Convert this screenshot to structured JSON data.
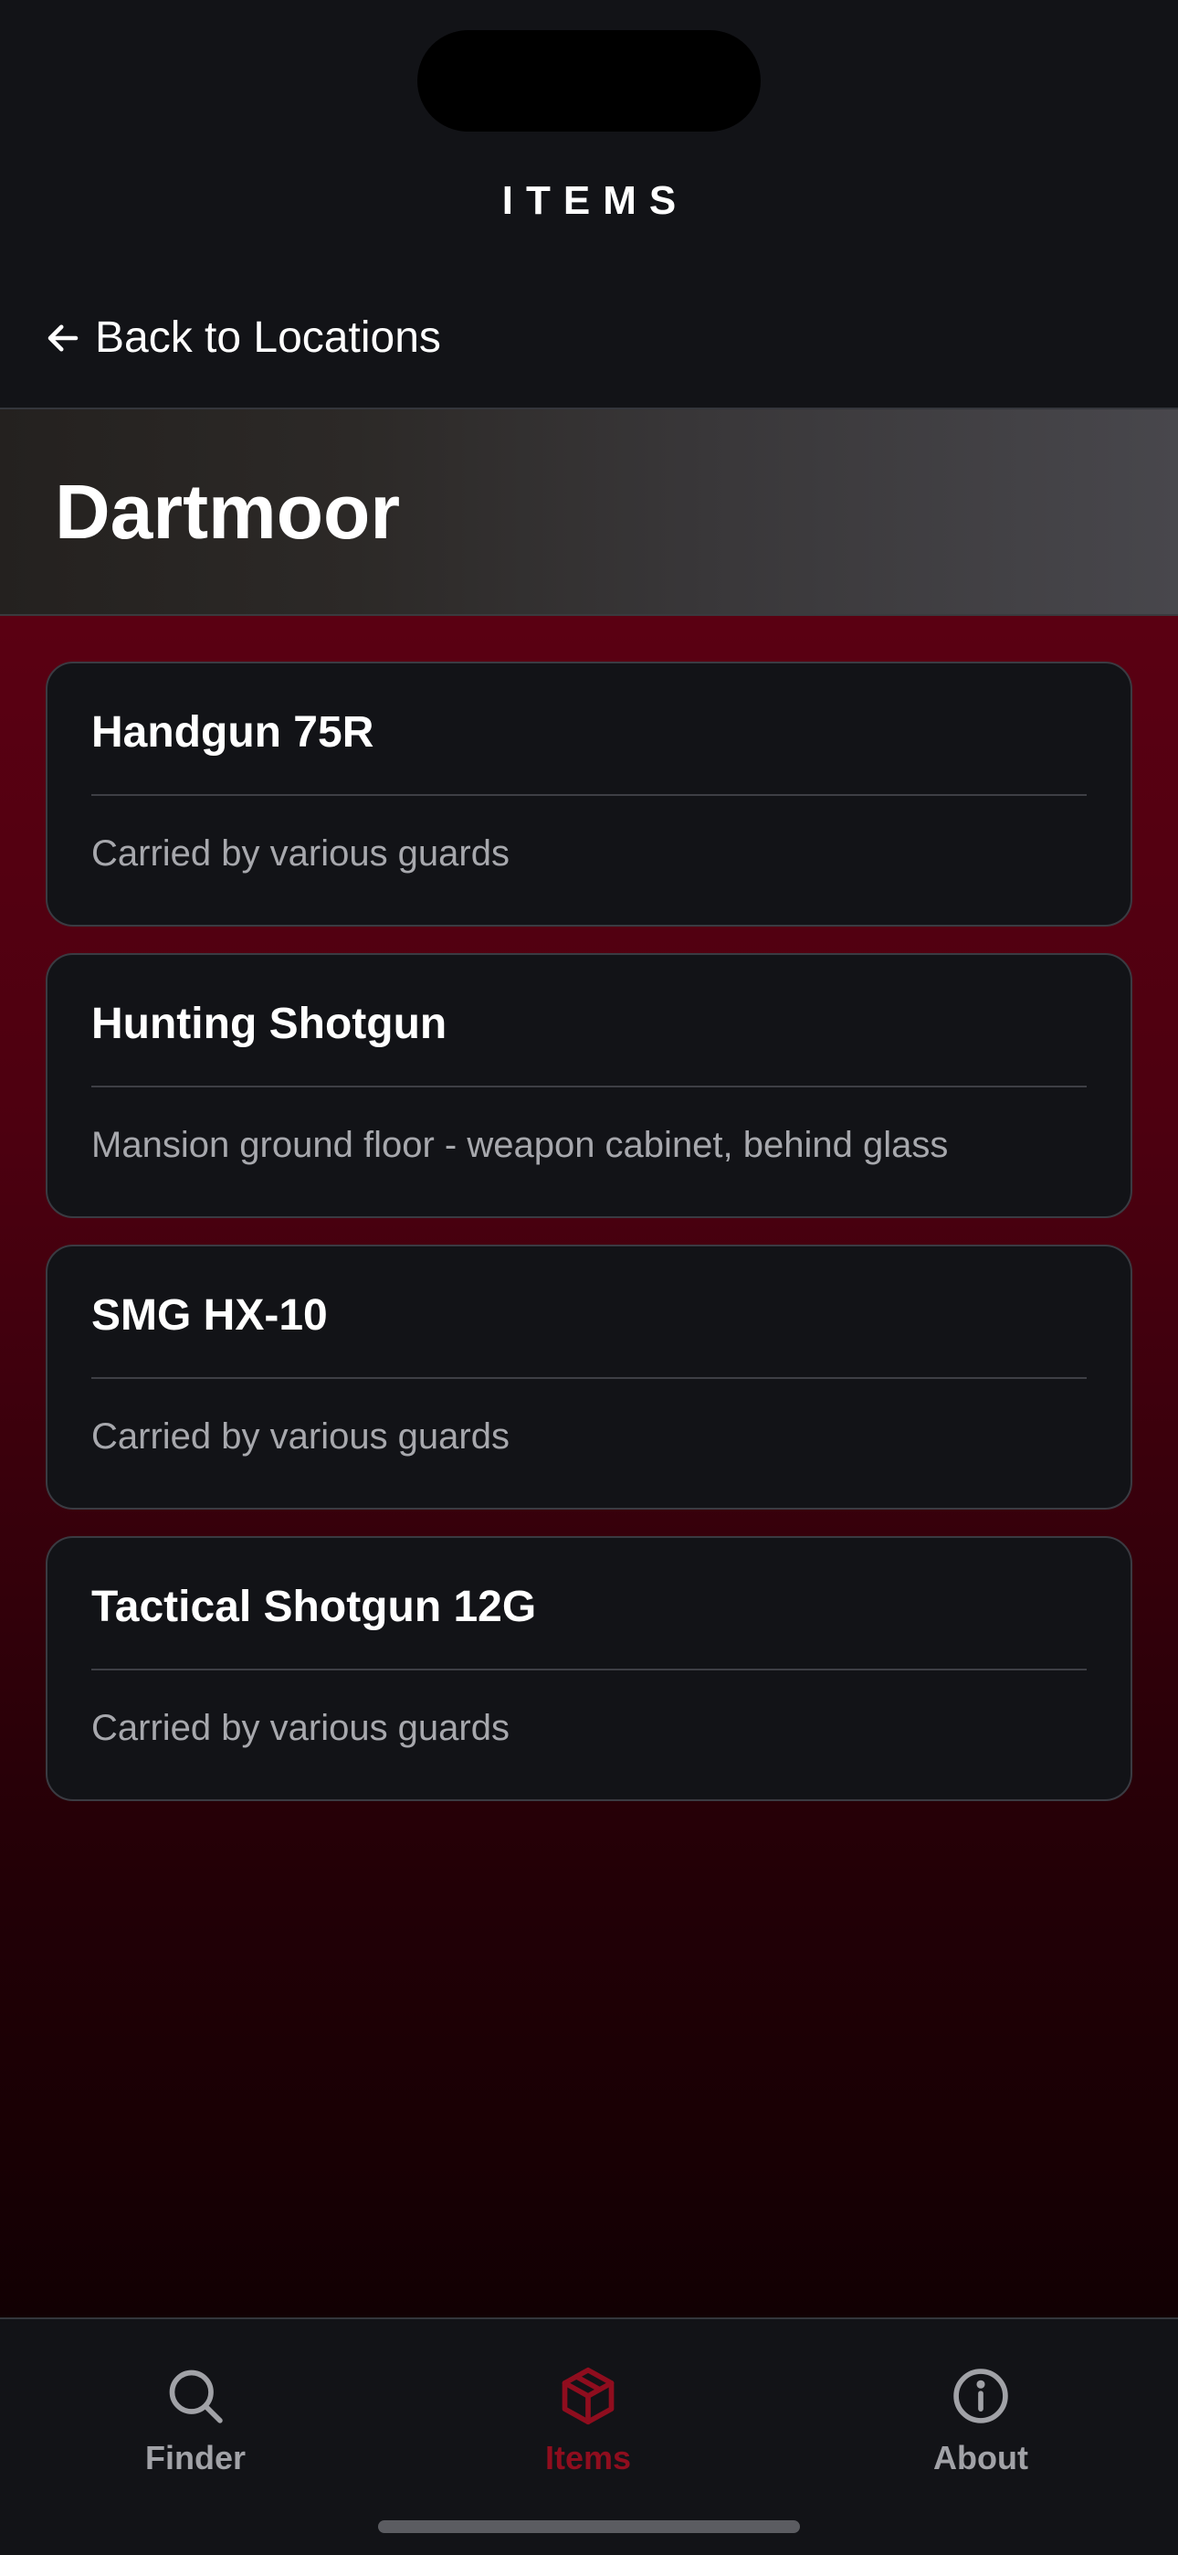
{
  "header": {
    "title": "ITEMS",
    "back_label": "Back to Locations"
  },
  "location": {
    "name": "Dartmoor"
  },
  "items": [
    {
      "name": "Handgun 75R",
      "location": "Carried by various guards"
    },
    {
      "name": "Hunting Shotgun",
      "location": "Mansion ground floor - weapon cabinet, behind glass"
    },
    {
      "name": "SMG HX-10",
      "location": "Carried by various guards"
    },
    {
      "name": "Tactical Shotgun 12G",
      "location": "Carried by various guards"
    }
  ],
  "tabs": [
    {
      "label": "Finder",
      "icon": "search-icon",
      "active": false
    },
    {
      "label": "Items",
      "icon": "box-icon",
      "active": true
    },
    {
      "label": "About",
      "icon": "info-icon",
      "active": false
    }
  ],
  "colors": {
    "accent": "#8f0d1e",
    "inactive_tab": "#a1a2a7",
    "card_background": "#121317",
    "content_gradient_top": "#5a0012",
    "content_gradient_bottom": "#120003"
  }
}
